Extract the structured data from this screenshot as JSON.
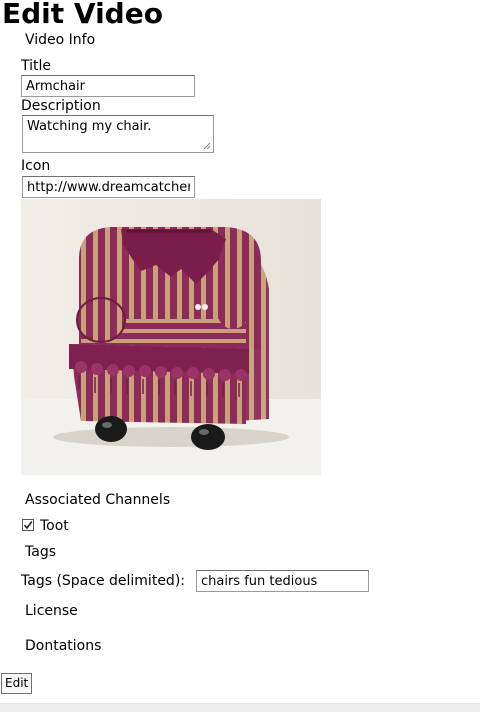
{
  "page": {
    "title": "Edit Video"
  },
  "video_info": {
    "legend": "Video Info",
    "title_label": "Title",
    "title_value": "Armchair",
    "description_label": "Description",
    "description_value": "Watching my chair.",
    "icon_label": "Icon",
    "icon_value": "http://www.dreamcatchercrafts.com/armchair.jpg"
  },
  "channels": {
    "legend": "Associated Channels",
    "items": [
      {
        "label": "Toot",
        "checked": true
      }
    ]
  },
  "tags": {
    "legend": "Tags",
    "field_label": "Tags (Space delimited):",
    "field_value": "chairs fun tedious"
  },
  "license": {
    "legend": "License"
  },
  "donations": {
    "legend": "Dontations"
  },
  "actions": {
    "submit_label": "Edit"
  },
  "colors": {
    "chair_fabric": "#8c2a5a",
    "chair_stripe": "#c9a07a",
    "chair_feet": "#1a1a1a"
  }
}
